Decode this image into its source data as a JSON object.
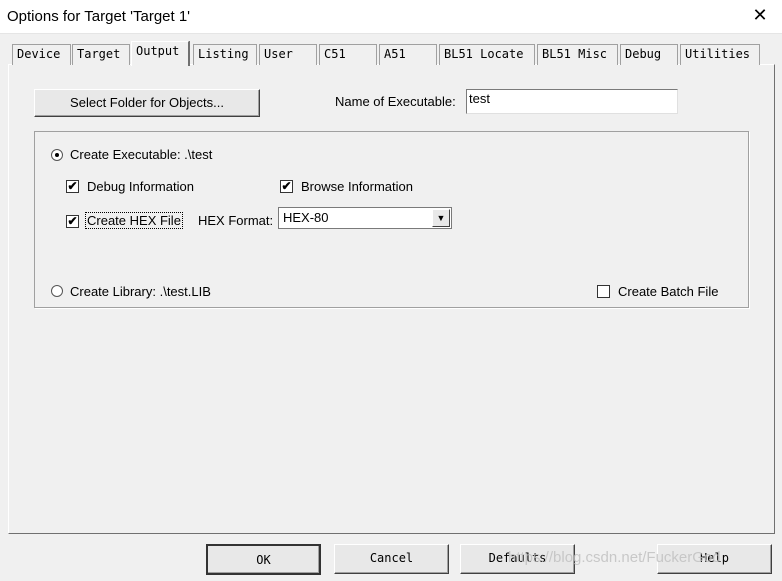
{
  "window": {
    "title": "Options for Target 'Target 1'",
    "close": "✕"
  },
  "tabs": [
    {
      "label": "Device"
    },
    {
      "label": "Target"
    },
    {
      "label": "Output",
      "active": true
    },
    {
      "label": "Listing"
    },
    {
      "label": "User"
    },
    {
      "label": "C51"
    },
    {
      "label": "A51"
    },
    {
      "label": "BL51 Locate"
    },
    {
      "label": "BL51 Misc"
    },
    {
      "label": "Debug"
    },
    {
      "label": "Utilities"
    }
  ],
  "output": {
    "select_folder": "Select Folder for Objects...",
    "name_label": "Name of Executable:",
    "name_value": "test",
    "create_exe": "Create Executable:  .\\test",
    "debug_info": "Debug Information",
    "browse_info": "Browse Information",
    "create_hex": "Create HEX File",
    "hex_format_label": "HEX Format:",
    "hex_format_value": "HEX-80",
    "create_lib": "Create Library:  .\\test.LIB",
    "create_batch": "Create Batch File",
    "checked": "✔"
  },
  "footer": {
    "ok": "OK",
    "cancel": "Cancel",
    "defaults": "Defaults",
    "help": "Help"
  },
  "watermark": "https://blog.csdn.net/FuckerGod"
}
